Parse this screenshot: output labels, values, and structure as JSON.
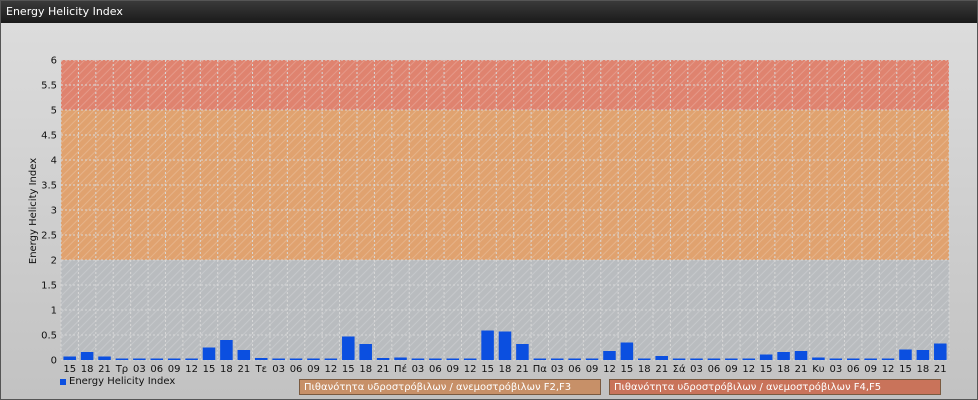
{
  "window": {
    "title": "Energy Helicity Index"
  },
  "legend": {
    "series_label": "Energy Helicity Index"
  },
  "bands": [
    {
      "label": "Πιθανότητα υδροστρόβιλων / ανεμοστρόβιλων F2,F3",
      "from": 2,
      "to": 5,
      "color": "#e0a26f"
    },
    {
      "label": "Πιθανότητα υδροστρόβιλων / ανεμοστρόβιλων F4,F5",
      "from": 5,
      "to": 6,
      "color": "#df836f"
    }
  ],
  "chart_data": {
    "type": "bar",
    "ylabel": "Energy Helicity Index",
    "ylim": [
      0,
      6
    ],
    "yticks": [
      "0",
      "0.5",
      "1",
      "1.5",
      "2",
      "2.5",
      "3",
      "3.5",
      "4",
      "4.5",
      "5",
      "5.5",
      "6"
    ],
    "bar_color": "#0b4fe0",
    "categories": [
      "15",
      "18",
      "21",
      "Τρ",
      "03",
      "06",
      "09",
      "12",
      "15",
      "18",
      "21",
      "Τε",
      "03",
      "06",
      "09",
      "12",
      "15",
      "18",
      "21",
      "Πέ",
      "03",
      "06",
      "09",
      "12",
      "15",
      "18",
      "21",
      "Πα",
      "03",
      "06",
      "09",
      "12",
      "15",
      "18",
      "21",
      "Σά",
      "03",
      "06",
      "09",
      "12",
      "15",
      "18",
      "21",
      "Κυ",
      "03",
      "06",
      "09",
      "12",
      "15",
      "18",
      "21"
    ],
    "series": [
      {
        "name": "Energy Helicity Index",
        "values": [
          0.07,
          0.16,
          0.07,
          0.03,
          0.03,
          0.03,
          0.03,
          0.03,
          0.25,
          0.4,
          0.2,
          0.04,
          0.03,
          0.03,
          0.03,
          0.03,
          0.47,
          0.32,
          0.04,
          0.05,
          0.03,
          0.03,
          0.03,
          0.03,
          0.59,
          0.57,
          0.32,
          0.03,
          0.03,
          0.03,
          0.03,
          0.18,
          0.35,
          0.03,
          0.08,
          0.03,
          0.03,
          0.03,
          0.03,
          0.03,
          0.11,
          0.16,
          0.18,
          0.05,
          0.03,
          0.03,
          0.03,
          0.03,
          0.21,
          0.2,
          0.33
        ]
      }
    ]
  }
}
